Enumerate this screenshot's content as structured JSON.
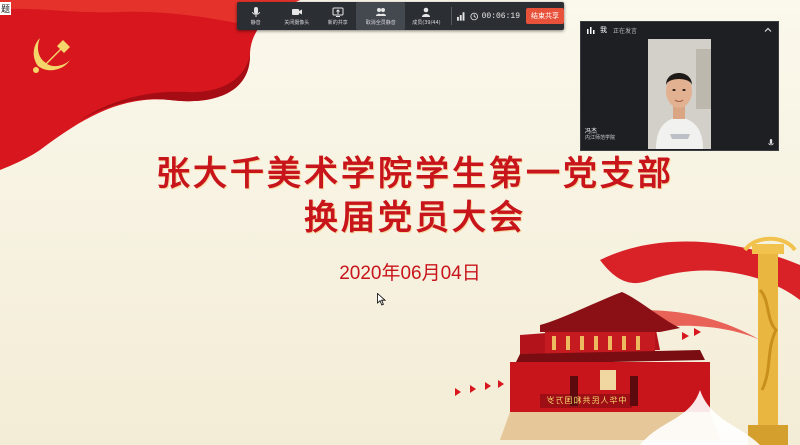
{
  "corner_text": "题",
  "slide": {
    "title_line1": "张大千美术学院学生第一党支部",
    "title_line2": "换届党员大会",
    "date": "2020年06月04日",
    "gate_banner": "中华人民共和国万岁"
  },
  "toolbar": {
    "buttons": [
      {
        "label": "静音",
        "icon": "microphone-icon"
      },
      {
        "label": "关闭摄像头",
        "icon": "camera-icon"
      },
      {
        "label": "新的共享",
        "icon": "share-screen-icon"
      },
      {
        "label": "取消全员静音",
        "icon": "mute-all-icon"
      },
      {
        "label": "成员(39/44)",
        "icon": "members-icon"
      }
    ],
    "timer": "00:06:19",
    "end_share_label": "结束共享"
  },
  "video_panel": {
    "name": "我",
    "status": "正在发言",
    "participant_name": "冯杰",
    "participant_org": "内江师范学院"
  },
  "colors": {
    "title_red": "#c8141b",
    "toolbar_bg": "#2b2e33",
    "end_share_button": "#e8513a"
  }
}
